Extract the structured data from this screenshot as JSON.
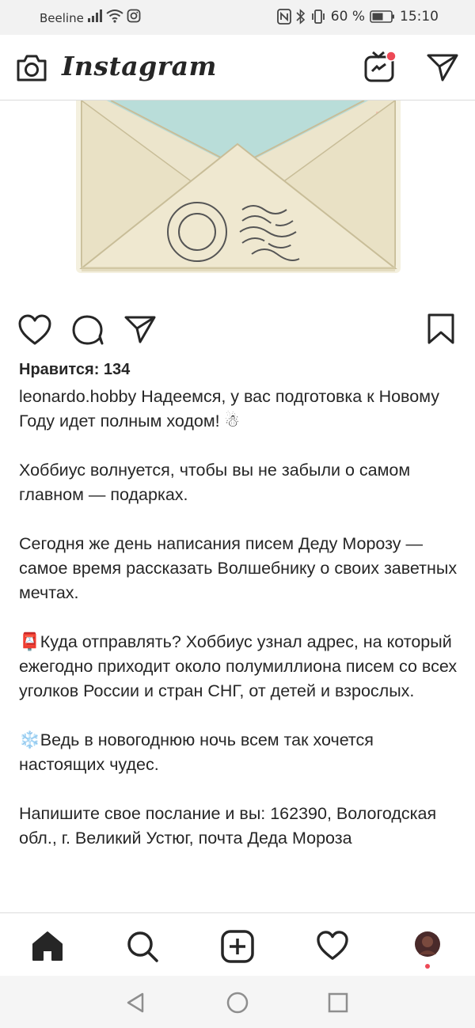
{
  "status_bar": {
    "carrier": "Beeline",
    "battery": "60 %",
    "time": "15:10"
  },
  "header": {
    "app_title": "Instagram"
  },
  "post": {
    "likes": "Нравится: 134",
    "username": "leonardo.hobby",
    "caption_first": "Надеемся, у вас подготовка к Новому Году идет полным ходом! ☃",
    "para2": "Хоббиус волнуется, чтобы вы не забыли о самом главном — подарках.",
    "para3": "Сегодня же день написания писем Деду Морозу — самое время рассказать Волшебнику о своих заветных мечтах.",
    "para4": "📮Куда отправлять? Хоббиус узнал адрес, на который ежегодно приходит около полумиллиона писем со всех уголков России и стран СНГ, от детей и взрослых.",
    "para5": "❄️Ведь в новогоднюю ночь всем так хочется настоящих чудес.",
    "para6": "Напишите свое послание и вы: 162390, Вологодская обл., г. Великий Устюг, почта Деда Мороза"
  },
  "icons": {
    "camera": "camera-icon",
    "igtv": "igtv-icon",
    "direct": "direct-message-icon",
    "like": "heart-icon",
    "comment": "comment-icon",
    "share": "share-icon",
    "save": "bookmark-icon",
    "home": "home-icon",
    "search": "search-icon",
    "add": "add-post-icon",
    "activity": "activity-heart-icon",
    "profile": "profile-avatar"
  },
  "colors": {
    "notification_dot": "#ed4956",
    "text": "#262626",
    "envelope_paper": "#ece5cc",
    "envelope_flap": "#b9ddd9"
  }
}
